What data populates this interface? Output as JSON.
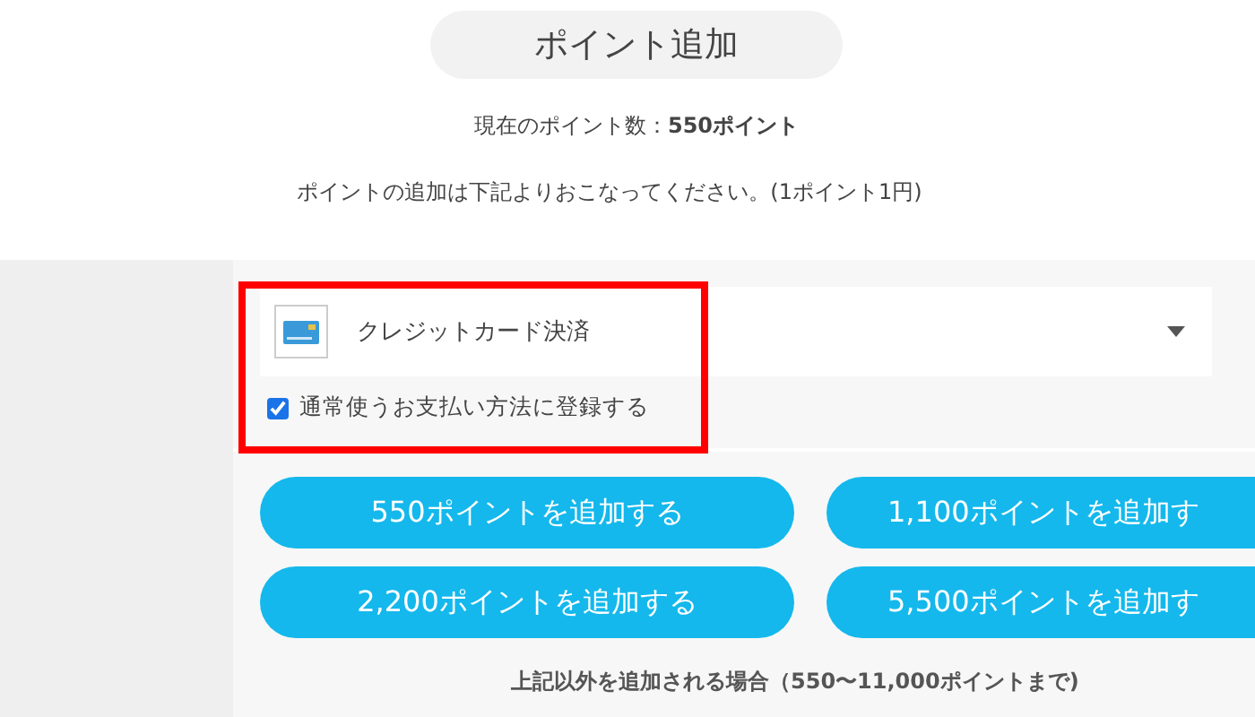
{
  "title": "ポイント追加",
  "current_points": "現在のポイント数：**550ポイント**",
  "instruction": "ポイントの追加は下記よりおこなってください。(1ポイント1円)",
  "payment_method": {
    "value": "クレジットカード決済"
  },
  "register_default": {
    "label": "通常使うお支払い方法に登録する",
    "checked": true
  },
  "add_buttons": [
    "550ポイントを追加する",
    "1,100ポイントを追加す",
    "2,200ポイントを追加する",
    "5,500ポイントを追加す"
  ],
  "other_amount_note": "上記以外を追加される場合（550〜11,000ポイントまで)"
}
